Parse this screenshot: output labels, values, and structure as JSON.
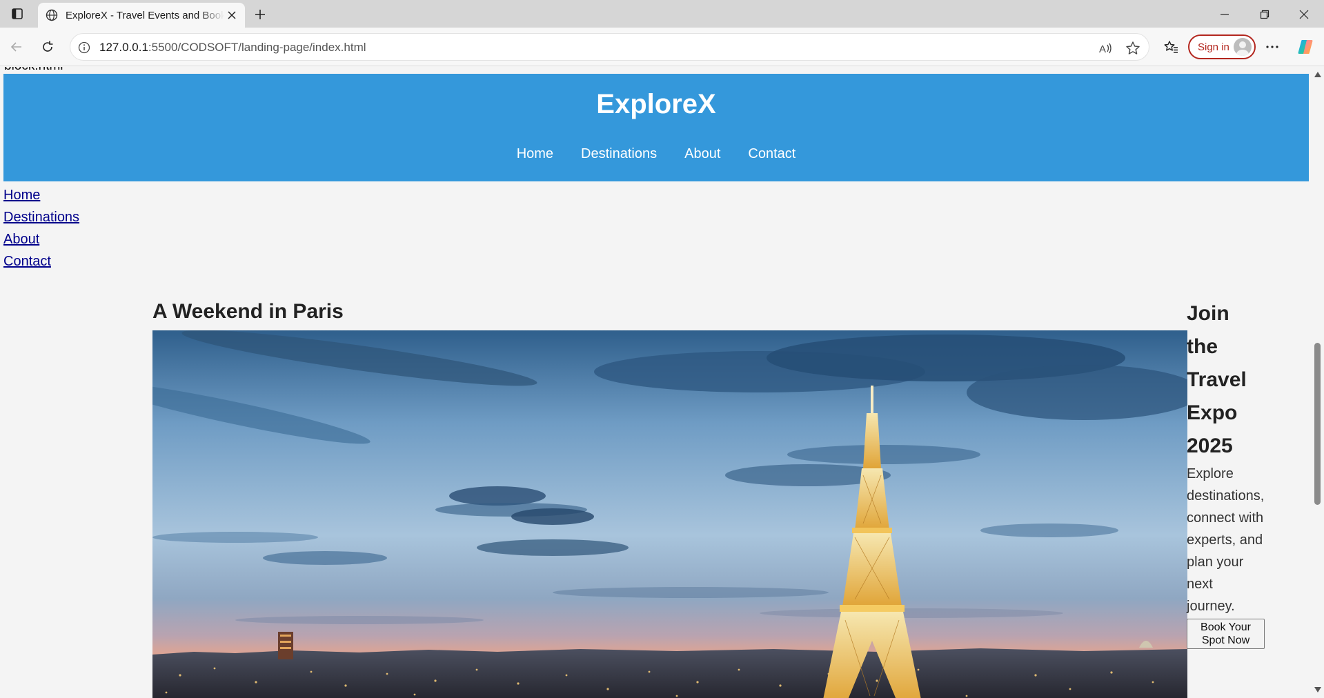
{
  "browser": {
    "tab_title": "ExploreX - Travel Events and Booking",
    "url_host": "127.0.0.1",
    "url_path": ":5500/CODSOFT/landing-page/index.html",
    "sign_in_label": "Sign in"
  },
  "page": {
    "previous_text": "block.html",
    "logo": "ExploreX",
    "nav": [
      "Home",
      "Destinations",
      "About",
      "Contact"
    ],
    "plain_links": [
      "Home",
      "Destinations",
      "About",
      "Contact"
    ],
    "event_title": "A Weekend in Paris",
    "promo": {
      "title_lines": [
        "Join",
        "the",
        "Travel",
        "Expo",
        "2025"
      ],
      "desc_lines": [
        "Explore",
        "destinations,",
        "connect with",
        "experts, and",
        "plan your",
        "next",
        "journey."
      ],
      "button_lines": [
        "Book Your",
        "Spot Now"
      ]
    }
  },
  "colors": {
    "header_bg": "#3498db",
    "link": "#00008b",
    "signin_accent": "#b3261e"
  },
  "icons": [
    "tab-actions-icon",
    "globe-icon",
    "close-icon",
    "plus-icon",
    "minimize-icon",
    "restore-icon",
    "back-arrow-icon",
    "refresh-icon",
    "info-icon",
    "read-aloud-icon",
    "star-icon",
    "favorites-icon",
    "more-icon",
    "copilot-icon"
  ]
}
